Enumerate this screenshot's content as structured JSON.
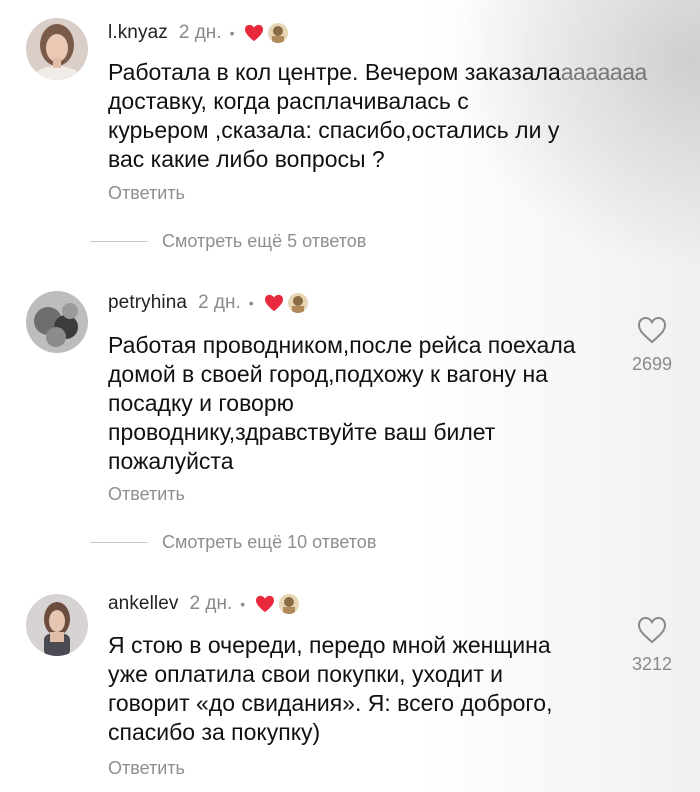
{
  "comments": [
    {
      "username": "l.knyaz",
      "time": "2 дн.",
      "dot": "•",
      "text_main": "Работала в кол центре. Вечером заказала",
      "text_fade": "ааааааа",
      "text_rest": "доставку, когда расплачивалась с\nкурьером ,сказала: спасибо,остались ли у\nвас какие либо вопросы ?",
      "reply": "Ответить",
      "more_replies": "Смотреть ещё 5 ответов"
    },
    {
      "username": "petryhina",
      "time": "2 дн.",
      "dot": "•",
      "text": "Работая проводником,после рейса поехала\nдомой в своей город,подхожу к вагону на\nпосадку и говорю\nпроводнику,здравствуйте ваш билет\nпожалуйста",
      "likes": "2699",
      "reply": "Ответить",
      "more_replies": "Смотреть ещё 10 ответов"
    },
    {
      "username": "ankellev",
      "time": "2 дн.",
      "dot": "•",
      "text": "Я стою в очереди, передо мной женщина\nуже оплатила свои покупки, уходит и\nговорит «до свидания». Я: всего доброго,\nспасибо за покупку)",
      "likes": "3212",
      "reply": "Ответить"
    }
  ],
  "icons": {
    "heart": "heart-icon",
    "like": "heart-outline-icon"
  },
  "colors": {
    "heart": "#e8283b",
    "muted": "#8a8a8a"
  }
}
